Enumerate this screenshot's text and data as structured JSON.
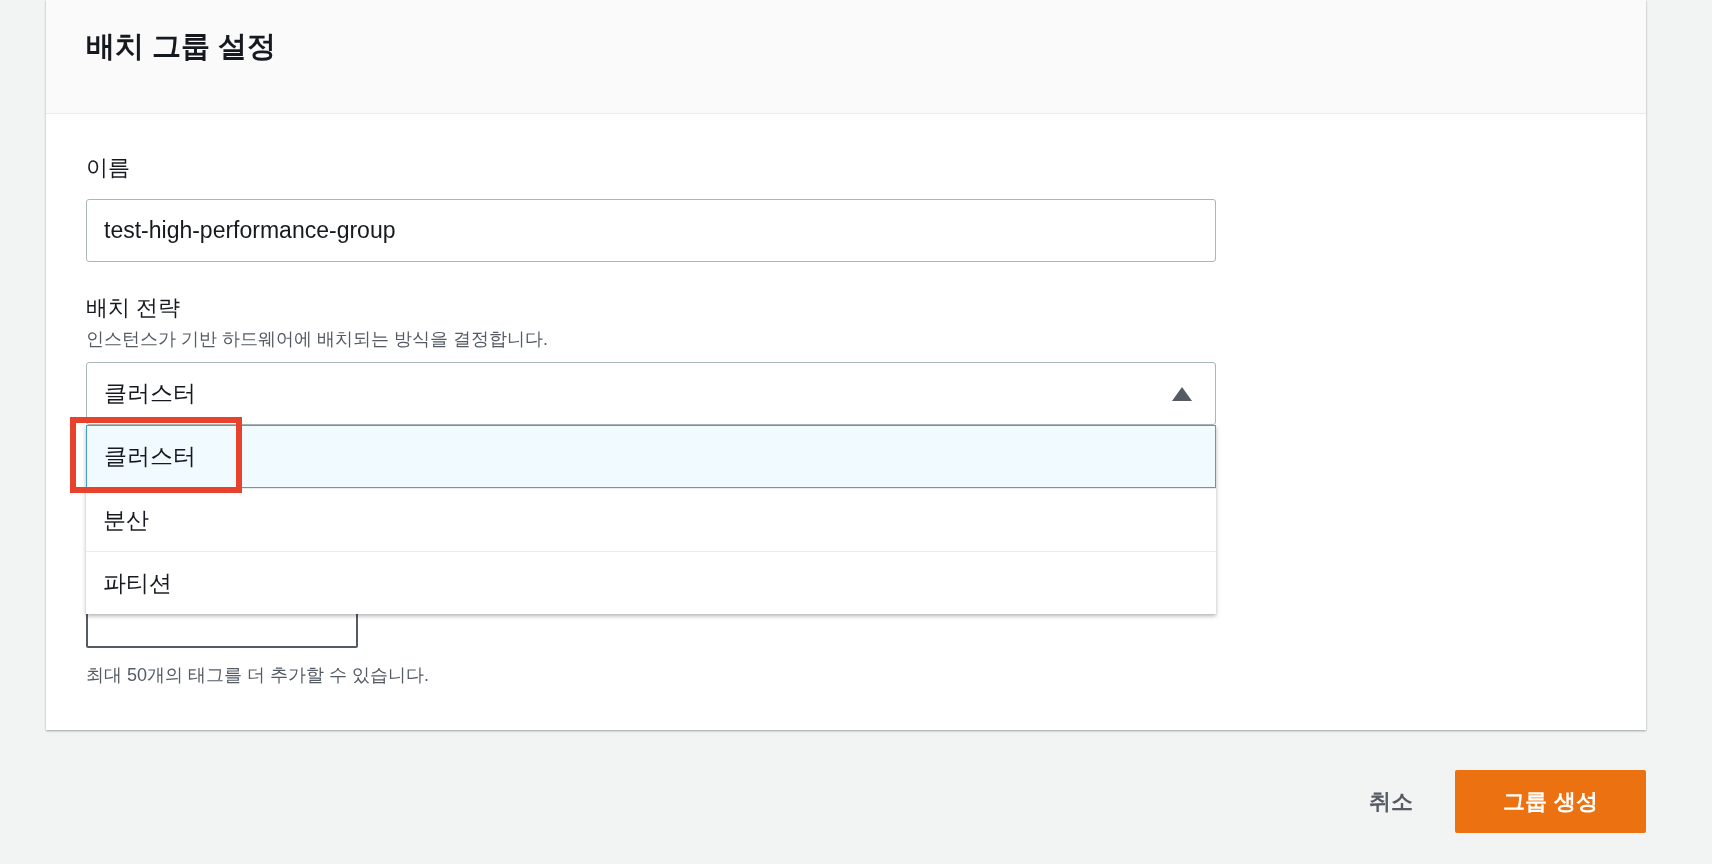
{
  "panel": {
    "title": "배치 그룹 설정"
  },
  "name_field": {
    "label": "이름",
    "value": "test-high-performance-group"
  },
  "strategy_field": {
    "label": "배치 전략",
    "description": "인스턴스가 기반 하드웨어에 배치되는 방식을 결정합니다.",
    "value": "클러스터",
    "expanded": true,
    "options": [
      {
        "label": "클러스터",
        "selected": true
      },
      {
        "label": "분산",
        "selected": false
      },
      {
        "label": "파티션",
        "selected": false
      }
    ]
  },
  "tags": {
    "help": "최대 50개의 태그를 더 추가할 수 있습니다."
  },
  "footer": {
    "cancel": "취소",
    "submit": "그룹 생성"
  }
}
